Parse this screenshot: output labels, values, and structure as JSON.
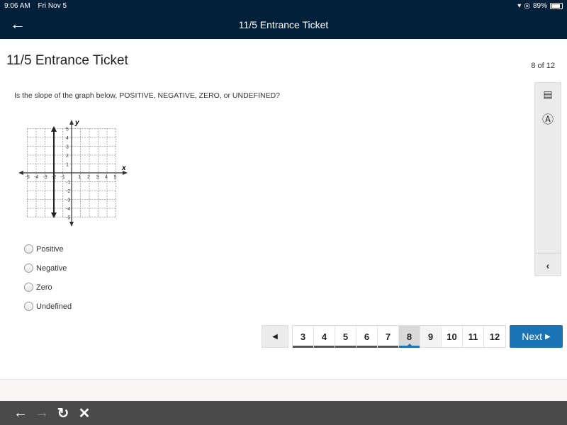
{
  "status_bar": {
    "time": "9:06 AM",
    "date": "Fri Nov 5",
    "battery": "89%"
  },
  "header": {
    "title": "11/5 Entrance Ticket",
    "back_icon": "arrow-left-icon"
  },
  "page": {
    "title": "11/5 Entrance Ticket",
    "counter": "8 of 12"
  },
  "side_panel": {
    "icons": [
      "item-list-icon",
      "accessibility-icon",
      "collapse-chevron-icon"
    ]
  },
  "question": {
    "text": "Is the slope of the graph below, POSITIVE, NEGATIVE, ZERO, or UNDEFINED?",
    "graph": {
      "x_label": "x",
      "y_label": "y",
      "x_ticks": [
        "-5",
        "-4",
        "-3",
        "-2",
        "-1",
        "1",
        "2",
        "3",
        "4",
        "5"
      ],
      "y_ticks": [
        "5",
        "4",
        "3",
        "2",
        "1",
        "-1",
        "-2",
        "-3",
        "-4",
        "-5"
      ],
      "line": "vertical line at x = -2"
    },
    "options": [
      {
        "label": "Positive",
        "selected": false
      },
      {
        "label": "Negative",
        "selected": false
      },
      {
        "label": "Zero",
        "selected": false
      },
      {
        "label": "Undefined",
        "selected": false
      }
    ]
  },
  "pagination": {
    "prev_icon": "triangle-left-icon",
    "pages": [
      "3",
      "4",
      "5",
      "6",
      "7",
      "8",
      "9",
      "10",
      "11",
      "12"
    ],
    "current": "8",
    "next_label": "Next"
  },
  "browser_bar": {
    "icons": [
      "back-arrow-icon",
      "forward-arrow-icon",
      "reload-icon",
      "close-icon"
    ]
  }
}
